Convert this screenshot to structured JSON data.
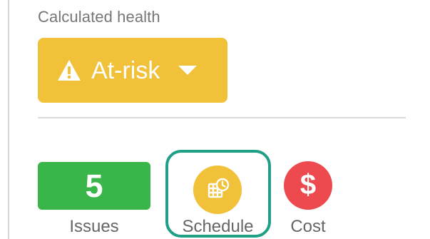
{
  "health": {
    "label": "Calculated health",
    "status": "At-risk",
    "status_color": "#f0c139",
    "warning_icon": "warning-icon",
    "dropdown_icon": "chevron-down-icon"
  },
  "metrics": {
    "issues": {
      "count": "5",
      "label": "Issues",
      "color": "#3ab54a"
    },
    "schedule": {
      "label": "Schedule",
      "icon": "calendar-clock-icon",
      "color": "#f0c139",
      "selected": true,
      "highlight_color": "#1f9f86"
    },
    "cost": {
      "icon_text": "$",
      "label": "Cost",
      "icon": "dollar-icon",
      "color": "#ec4a4e"
    }
  }
}
